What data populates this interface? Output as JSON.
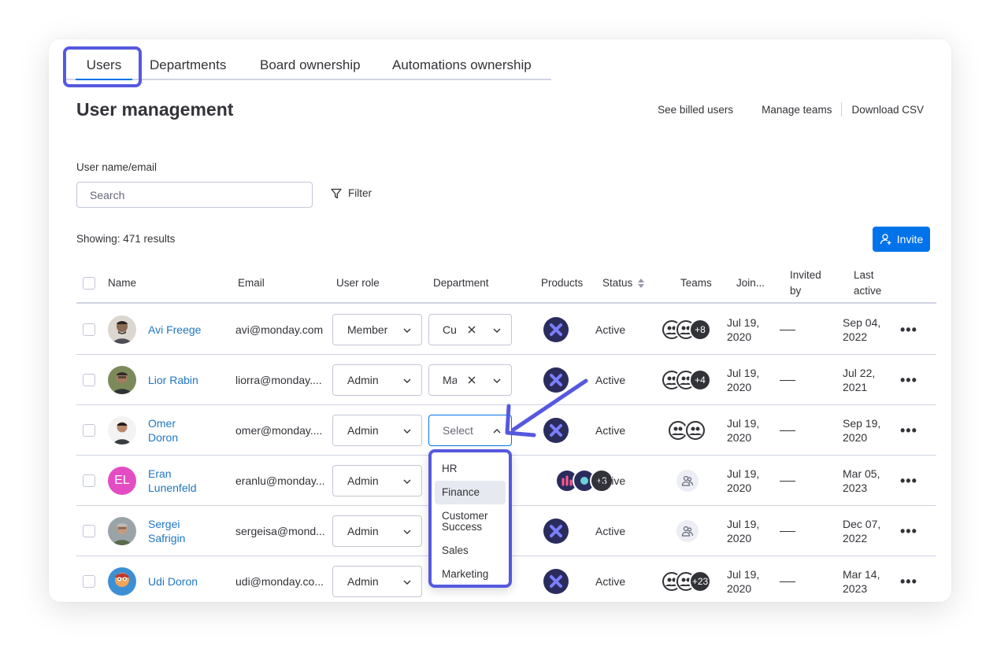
{
  "tabs": [
    {
      "label": "Users"
    },
    {
      "label": "Departments"
    },
    {
      "label": "Board ownership"
    },
    {
      "label": "Automations ownership"
    }
  ],
  "page": {
    "title": "User management",
    "links": {
      "billed": "See billed users",
      "teams": "Manage teams",
      "csv": "Download CSV"
    },
    "search_label": "User name/email",
    "search_placeholder": "Search",
    "filter_label": "Filter",
    "showing": "Showing: 471 results",
    "invite_label": "Invite"
  },
  "table": {
    "headers": {
      "name": "Name",
      "email": "Email",
      "role": "User role",
      "department": "Department",
      "products": "Products",
      "status": "Status",
      "teams": "Teams",
      "joined": "Join...",
      "invited_1": "Invited",
      "invited_2": "by",
      "last_1": "Last",
      "last_2": "active"
    },
    "rows": [
      {
        "name_1": "Avi Freege",
        "name_2": "",
        "email": "avi@monday.com",
        "role": "Member",
        "dept": "Cus",
        "status": "Active",
        "team_extra": "+8",
        "joined_1": "Jul 19,",
        "joined_2": "2020",
        "last_1": "Sep 04,",
        "last_2": "2022"
      },
      {
        "name_1": "Lior Rabin",
        "name_2": "",
        "email": "liorra@monday....",
        "role": "Admin",
        "dept": "Ma",
        "status": "Active",
        "team_extra": "+4",
        "joined_1": "Jul 19,",
        "joined_2": "2020",
        "last_1": "Jul 22,",
        "last_2": "2021"
      },
      {
        "name_1": "Omer",
        "name_2": "Doron",
        "email": "omer@monday....",
        "role": "Admin",
        "dept": "Select",
        "status": "Active",
        "team_extra": "",
        "joined_1": "Jul 19,",
        "joined_2": "2020",
        "last_1": "Sep 19,",
        "last_2": "2020"
      },
      {
        "name_1": "Eran",
        "name_2": "Lunenfeld",
        "email": "eranlu@monday...",
        "role": "Admin",
        "dept": "",
        "status": "Active",
        "initials": "EL",
        "product_extra": "+3",
        "joined_1": "Jul 19,",
        "joined_2": "2020",
        "last_1": "Mar 05,",
        "last_2": "2023"
      },
      {
        "name_1": "Sergei",
        "name_2": "Safrigin",
        "email": "sergeisa@mond...",
        "role": "Admin",
        "dept": "",
        "status": "Active",
        "joined_1": "Jul 19,",
        "joined_2": "2020",
        "last_1": "Dec 07,",
        "last_2": "2022"
      },
      {
        "name_1": "Udi Doron",
        "name_2": "",
        "email": "udi@monday.co...",
        "role": "Admin",
        "dept": "",
        "status": "Active",
        "team_extra": "+23",
        "joined_1": "Jul 19,",
        "joined_2": "2020",
        "last_1": "Mar 14,",
        "last_2": "2023"
      }
    ]
  },
  "dropdown": {
    "options": [
      "HR",
      "Finance",
      "Customer Success",
      "Sales",
      "Marketing"
    ],
    "highlighted": "Finance"
  },
  "colors": {
    "accent": "#0073ea",
    "highlight": "#5559df",
    "link": "#1f76c2",
    "initials_avatar": "#e44cc3"
  }
}
